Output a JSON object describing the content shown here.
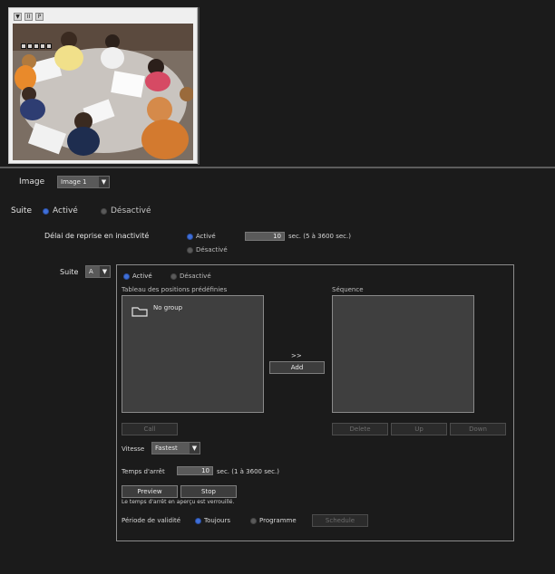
{
  "preview": {
    "buttons": [
      "▼",
      "II",
      "P"
    ]
  },
  "image_row": {
    "label": "Image",
    "selected": "Image 1"
  },
  "suite_row": {
    "label": "Suite",
    "on_label": "Activé",
    "off_label": "Désactivé"
  },
  "inactivity": {
    "label": "Délai de reprise en inactivité",
    "on_label": "Activé",
    "off_label": "Désactivé",
    "value": "10",
    "unit_text": "sec. (5 à 3600 sec.)"
  },
  "suite_panel": {
    "select_label": "Suite",
    "select_value": "A",
    "on_label": "Activé",
    "off_label": "Désactivé",
    "presets_header": "Tableau des positions prédéfinies",
    "sequence_header": "Séquence",
    "folder_item": "No group",
    "add_arrows": ">>",
    "add_label": "Add",
    "call_label": "Call",
    "delete_label": "Delete",
    "up_label": "Up",
    "down_label": "Down",
    "speed_label": "Vitesse",
    "speed_value": "Fastest",
    "stop_time_label": "Temps d'arrêt",
    "stop_time_value": "10",
    "stop_time_unit": "sec. (1 à 3600 sec.)",
    "preview_label": "Preview",
    "stop_label": "Stop",
    "lock_note": "Le temps d'arrêt en aperçu est verrouillé.",
    "period_label": "Période de validité",
    "always_label": "Toujours",
    "schedule_label": "Programme",
    "schedule_button": "Schedule"
  },
  "colors": {
    "accent": "#3f6fd8",
    "background": "#1b1b1b",
    "listbox": "#3f3f3f"
  }
}
